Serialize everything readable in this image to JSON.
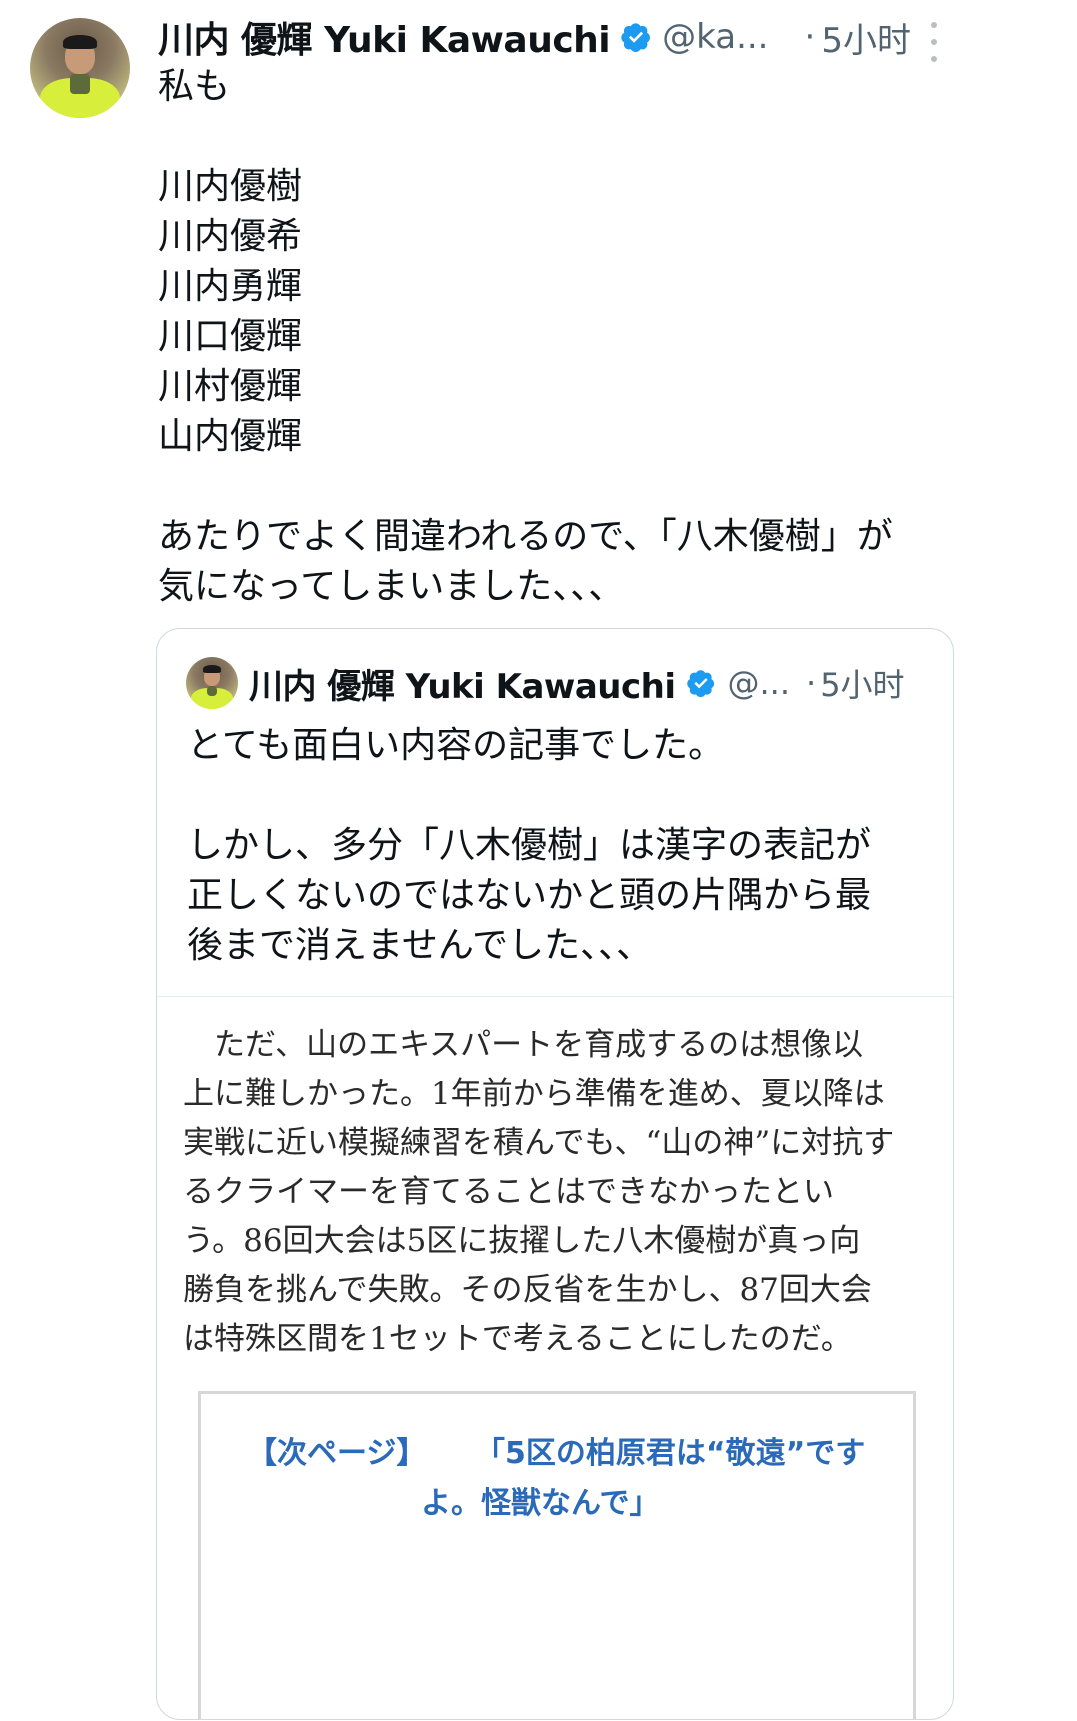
{
  "tweet": {
    "author_name": "川内 優輝 Yuki Kawauchi",
    "handle": "@ka...",
    "separator": "·",
    "time": "5小时",
    "text": "私も\n\n川内優樹\n川内優希\n川内勇輝\n川口優輝\n川村優輝\n山内優輝\n\nあたりでよく間違われるので、「八木優樹」が\n気になってしまいました、、、"
  },
  "quoted_tweet": {
    "author_name": "川内 優輝 Yuki Kawauchi",
    "handle": "@...",
    "separator": "·",
    "time": "5小时",
    "text": "とても面白い内容の記事でした。\n\nしかし、多分「八木優樹」は漢字の表記が\n正しくないのではないかと頭の片隅から最\n後まで消えませんでした、、、",
    "article_text": "　ただ、山のエキスパートを育成するのは想像以\n上に難しかった。1年前から準備を進め、夏以降は\n実戦に近い模擬練習を積んでも、“山の神”に対抗す\nるクライマーを育てることはできなかったとい\nう。86回大会は5区に抜擢した八木優樹が真っ向\n勝負を挑んで失敗。その反省を生かし、87回大会\nは特殊区間を1セットで考えることにしたのだ。",
    "next_page_label": "【次ページ】",
    "next_page_title_line1": "「5区の柏原君は“敬遠”です",
    "next_page_title_line2": "よ。怪獣なんで」"
  },
  "colors": {
    "verified_badge": "#1d9bf0",
    "secondary_text": "#536471",
    "link_blue": "#2b6ab8"
  }
}
